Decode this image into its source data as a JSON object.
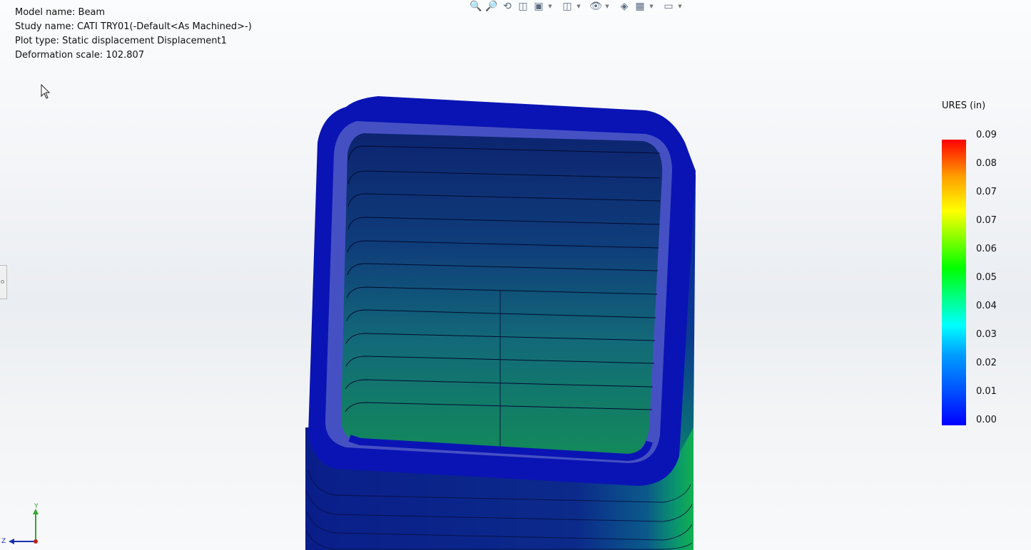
{
  "info": {
    "model_name": "Model name: Beam",
    "study_name": "Study name: CATI TRY01(-Default<As Machined>-)",
    "plot_type": "Plot type: Static displacement Displacement1",
    "deformation_scale": "Deformation scale: 102.807"
  },
  "toolbar": {
    "icons": [
      "zoom-to-fit-icon",
      "zoom-to-area-icon",
      "previous-view-icon",
      "section-view-icon",
      "view-orientation-icon",
      "display-style-icon",
      "hide-show-items-icon",
      "edit-appearance-icon",
      "apply-scene-icon",
      "view-settings-icon"
    ]
  },
  "legend": {
    "title": "URES (in)",
    "labels": [
      "0.09",
      "0.08",
      "0.07",
      "0.07",
      "0.06",
      "0.05",
      "0.04",
      "0.03",
      "0.02",
      "0.01",
      "0.00"
    ],
    "colors": {
      "min": "#0000ff",
      "mid": "#00ff00",
      "max": "#ff0000"
    }
  },
  "triad": {
    "y_label": "Y",
    "z_label": "Z"
  }
}
